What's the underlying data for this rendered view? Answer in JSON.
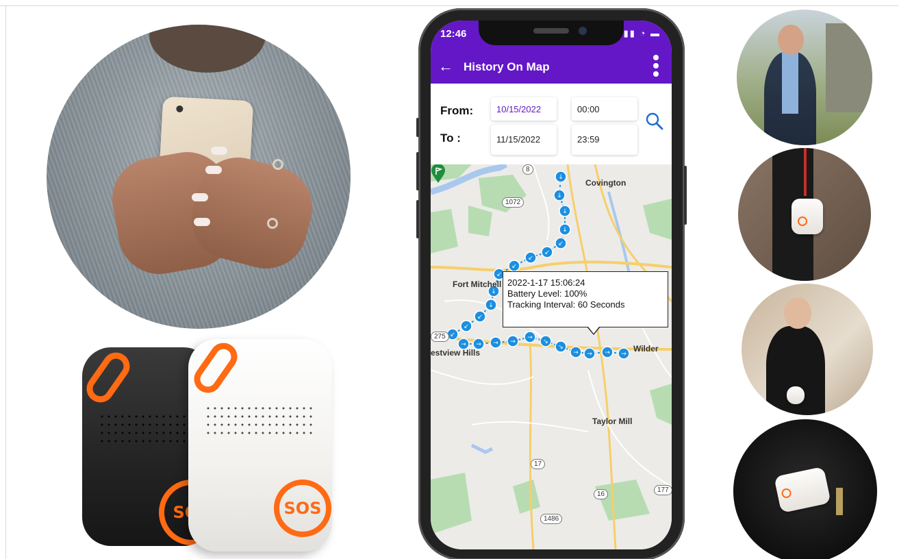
{
  "app": {
    "status_time": "12:46",
    "status_icons": "▮▮ ◔ ▬",
    "title": "History On Map",
    "back_icon": "arrow-left-icon",
    "menu_icon": "more-vertical-icon"
  },
  "filter": {
    "from_label": "From:",
    "to_label": "To :",
    "from_date": "10/15/2022",
    "from_time": "00:00",
    "to_date": "11/15/2022",
    "to_time": "23:59",
    "search_icon": "search-icon"
  },
  "map": {
    "places": [
      "Covington",
      "Fort Mitchell",
      "estview Hills",
      "Wilder",
      "Taylor Mill"
    ],
    "routes": [
      "8",
      "1072",
      "275",
      "17",
      "16",
      "177",
      "1486"
    ],
    "tooltip": {
      "timestamp": "2022-1-17 15:06:24",
      "battery": "Battery Level: 100%",
      "interval": "Tracking Interval: 60 Seconds"
    }
  },
  "devices": {
    "black_label": "SOS",
    "white_label": "SOS"
  },
  "colors": {
    "app_bar": "#6417c6",
    "accent_orange": "#ff6a13",
    "track_blue": "#1c8fe0",
    "map_green": "#b7dcb2",
    "road_yellow": "#f6cf6a"
  }
}
